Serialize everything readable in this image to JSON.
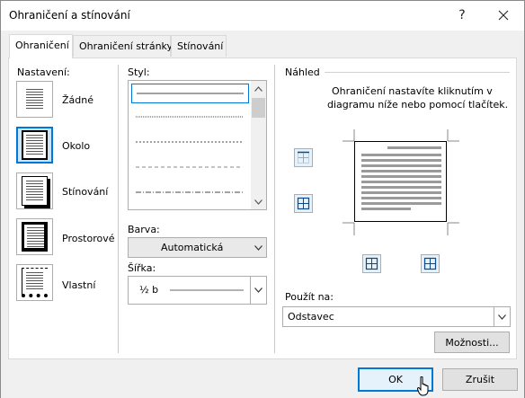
{
  "window": {
    "title": "Ohraničení a stínování",
    "help_label": "?",
    "close_label": "✕"
  },
  "tabs": [
    {
      "label": "Ohraničení",
      "active": true
    },
    {
      "label": "Ohraničení stránky",
      "active": false
    },
    {
      "label": "Stínování",
      "active": false
    }
  ],
  "settings": {
    "heading": "Nastavení:",
    "items": [
      {
        "label": "Žádné",
        "icon": "none-border-icon",
        "selected": false
      },
      {
        "label": "Okolo",
        "icon": "box-border-icon",
        "selected": true
      },
      {
        "label": "Stínování",
        "icon": "shadow-border-icon",
        "selected": false
      },
      {
        "label": "Prostorové",
        "icon": "3d-border-icon",
        "selected": false
      },
      {
        "label": "Vlastní",
        "icon": "custom-border-icon",
        "selected": false
      }
    ]
  },
  "style": {
    "heading": "Styl:",
    "items": [
      "solid",
      "dotted",
      "dashed-fine",
      "dashed",
      "dash-dot"
    ],
    "selected_index": 0
  },
  "color": {
    "heading": "Barva:",
    "value": "Automatická"
  },
  "width": {
    "heading": "Šířka:",
    "value": "½ b"
  },
  "preview": {
    "heading": "Náhled",
    "instruction_line1": "Ohraničení nastavíte kliknutím v",
    "instruction_line2": "diagramu níže nebo pomocí tlačítek."
  },
  "apply_to": {
    "heading": "Použít na:",
    "value": "Odstavec"
  },
  "buttons": {
    "options": "Možnosti...",
    "ok": "OK",
    "cancel": "Zrušit"
  },
  "colors": {
    "accent": "#0078d7",
    "dialog_bg": "#f0f0f0",
    "panel_bg": "#ffffff"
  }
}
